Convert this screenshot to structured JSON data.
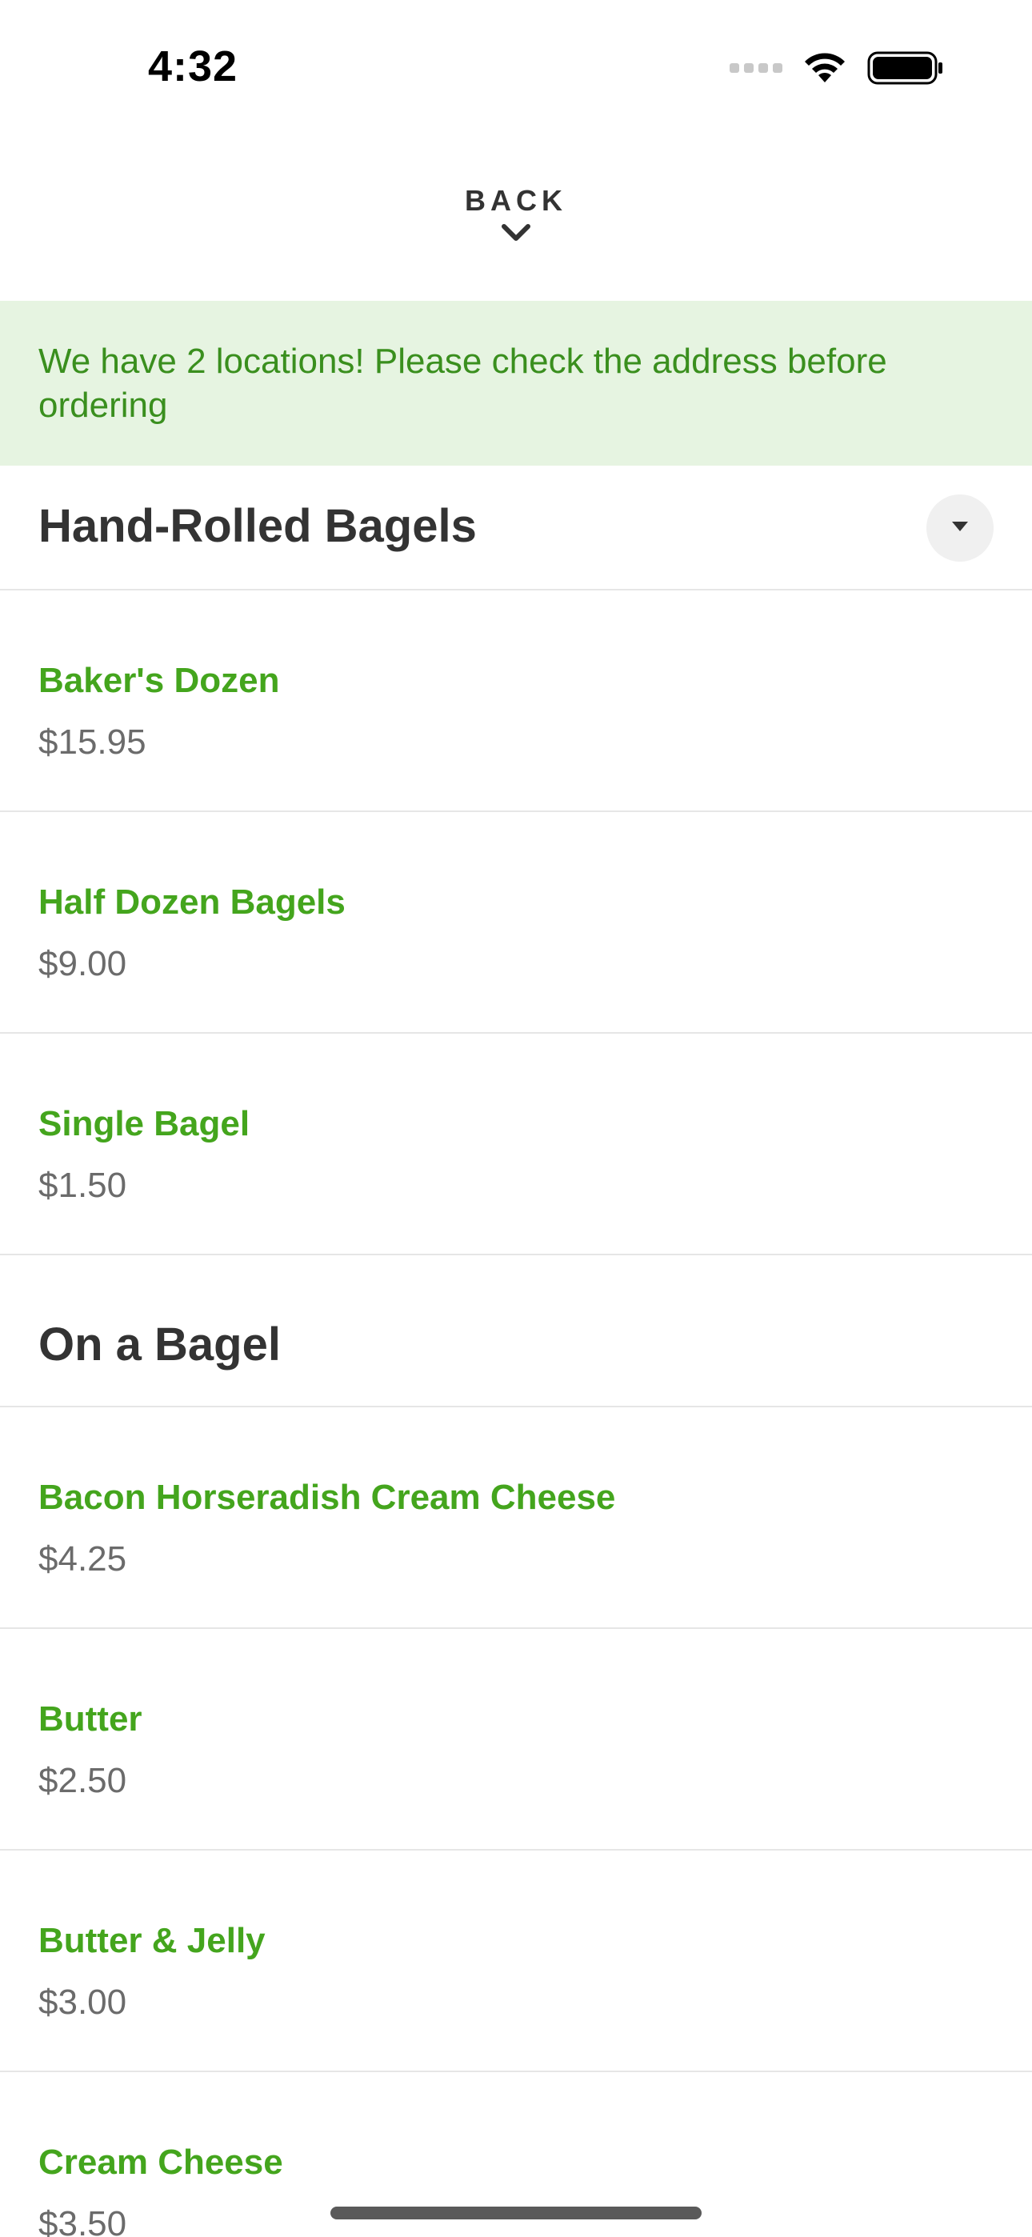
{
  "status_bar": {
    "time": "4:32"
  },
  "header": {
    "back_label": "BACK"
  },
  "banner": {
    "text": "We have 2 locations! Please check the address before ordering"
  },
  "sections": [
    {
      "title": "Hand-Rolled Bagels",
      "items": [
        {
          "name": "Baker's Dozen",
          "price": "$15.95"
        },
        {
          "name": "Half Dozen Bagels",
          "price": "$9.00"
        },
        {
          "name": "Single Bagel",
          "price": "$1.50"
        }
      ]
    },
    {
      "title": "On a Bagel",
      "items": [
        {
          "name": "Bacon Horseradish Cream Cheese",
          "price": "$4.25"
        },
        {
          "name": "Butter",
          "price": "$2.50"
        },
        {
          "name": "Butter & Jelly",
          "price": "$3.00"
        },
        {
          "name": "Cream Cheese",
          "price": "$3.50"
        }
      ]
    }
  ],
  "icons": {
    "collapse": "caret-down-icon",
    "back": "chevron-down-icon"
  },
  "colors": {
    "accent_green": "#44a51d",
    "banner_bg": "#e6f4e1",
    "banner_text": "#3a8f1e",
    "price_gray": "#6b6b6b"
  }
}
